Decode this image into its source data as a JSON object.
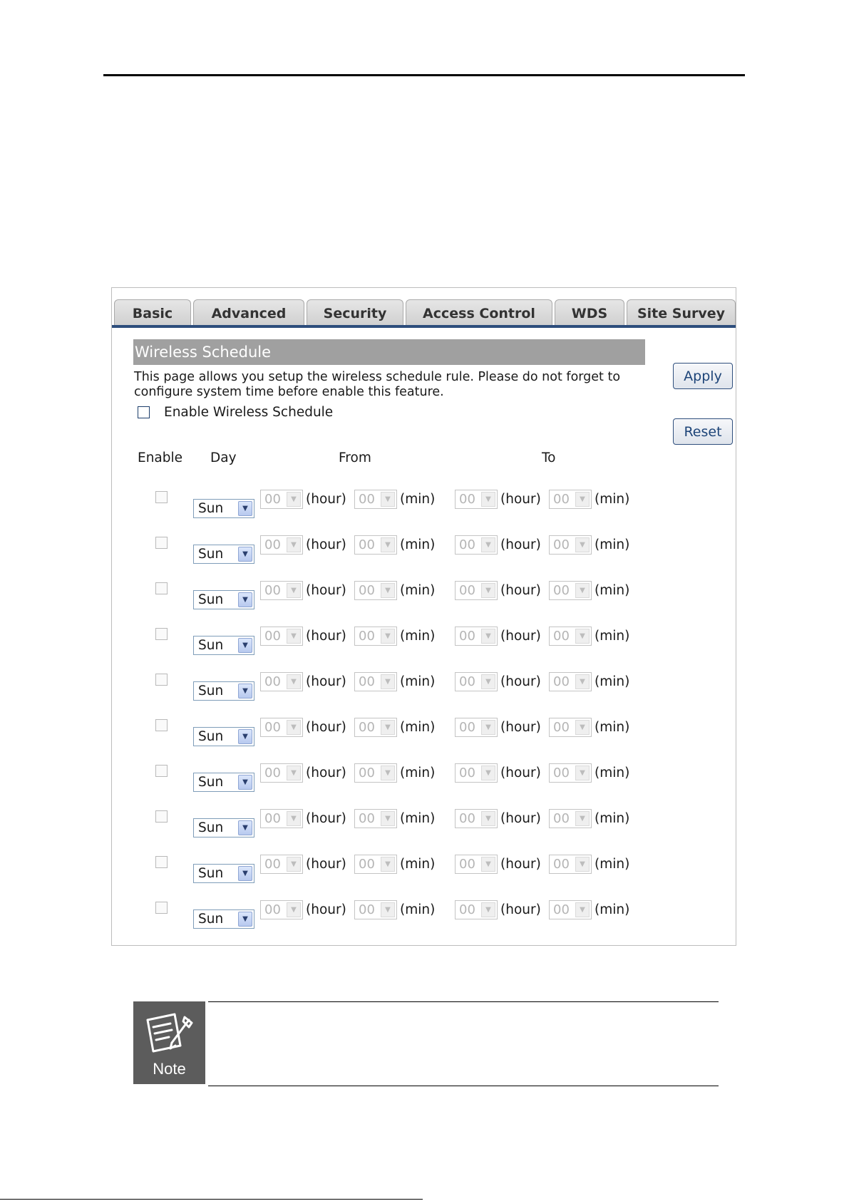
{
  "tabs": [
    {
      "label": "Basic"
    },
    {
      "label": "Advanced"
    },
    {
      "label": "Security"
    },
    {
      "label": "Access Control"
    },
    {
      "label": "WDS"
    },
    {
      "label": "Site Survey"
    }
  ],
  "section": {
    "title": "Wireless Schedule",
    "description": "This page allows you setup the wireless schedule rule. Please do not forget to configure system time before enable this feature.",
    "enable_label": "Enable Wireless Schedule"
  },
  "buttons": {
    "apply": "Apply",
    "reset": "Reset"
  },
  "columns": {
    "enable": "Enable",
    "day": "Day",
    "from": "From",
    "to": "To"
  },
  "units": {
    "hour": "(hour)",
    "min": "(min)"
  },
  "rows": [
    {
      "day": "Sun",
      "from_hour": "00",
      "from_min": "00",
      "to_hour": "00",
      "to_min": "00"
    },
    {
      "day": "Sun",
      "from_hour": "00",
      "from_min": "00",
      "to_hour": "00",
      "to_min": "00"
    },
    {
      "day": "Sun",
      "from_hour": "00",
      "from_min": "00",
      "to_hour": "00",
      "to_min": "00"
    },
    {
      "day": "Sun",
      "from_hour": "00",
      "from_min": "00",
      "to_hour": "00",
      "to_min": "00"
    },
    {
      "day": "Sun",
      "from_hour": "00",
      "from_min": "00",
      "to_hour": "00",
      "to_min": "00"
    },
    {
      "day": "Sun",
      "from_hour": "00",
      "from_min": "00",
      "to_hour": "00",
      "to_min": "00"
    },
    {
      "day": "Sun",
      "from_hour": "00",
      "from_min": "00",
      "to_hour": "00",
      "to_min": "00"
    },
    {
      "day": "Sun",
      "from_hour": "00",
      "from_min": "00",
      "to_hour": "00",
      "to_min": "00"
    },
    {
      "day": "Sun",
      "from_hour": "00",
      "from_min": "00",
      "to_hour": "00",
      "to_min": "00"
    },
    {
      "day": "Sun",
      "from_hour": "00",
      "from_min": "00",
      "to_hour": "00",
      "to_min": "00"
    }
  ],
  "note": {
    "label": "Note",
    "icon": "note-icon"
  },
  "colors": {
    "tab_line": "#2d4d7c",
    "section_header": "#a0a0a0",
    "button_text": "#1d4478"
  }
}
